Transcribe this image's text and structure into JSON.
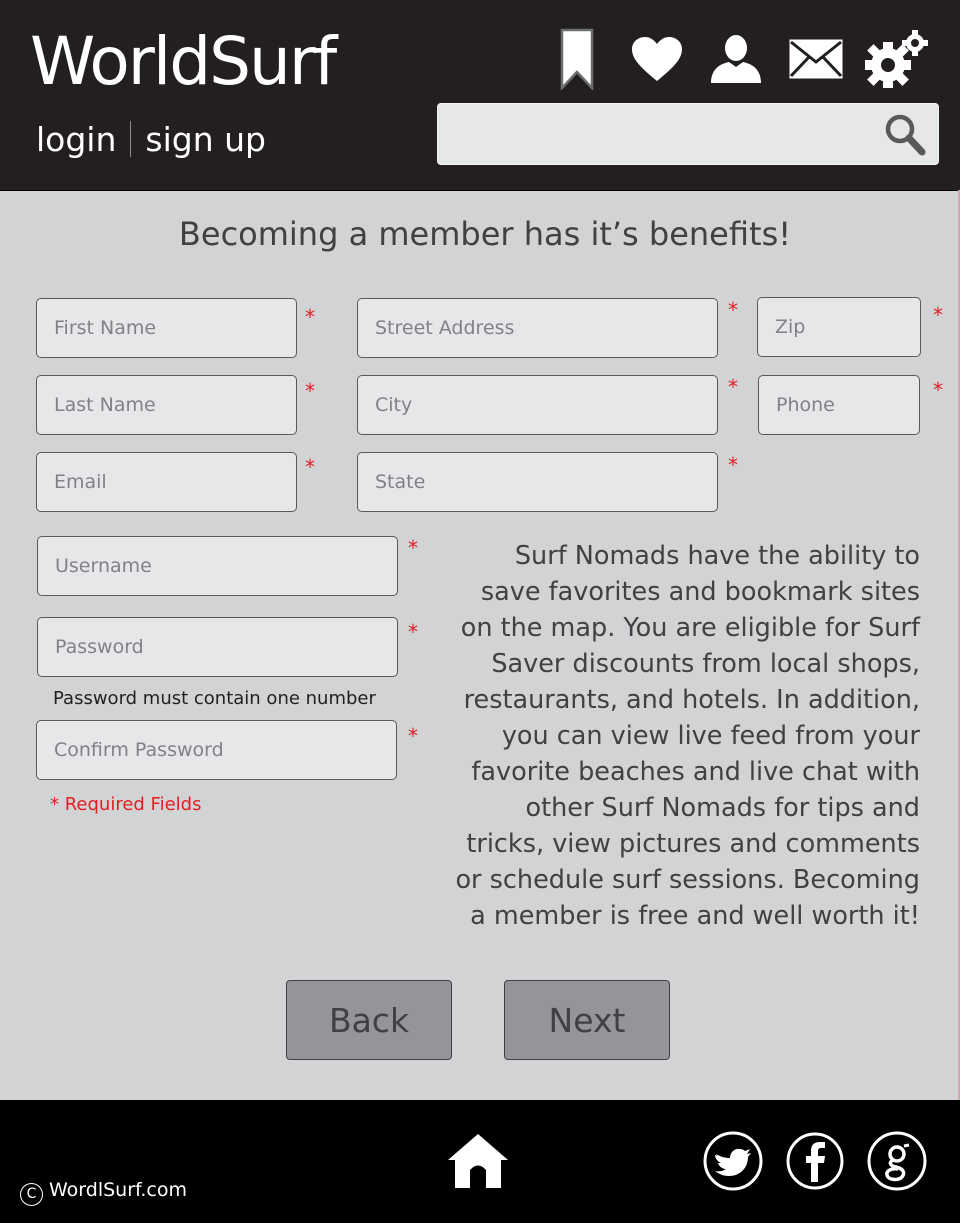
{
  "header": {
    "logo": "WorldSurf",
    "login": "login",
    "signup": "sign up",
    "icons": [
      "bookmark-icon",
      "heart-icon",
      "user-icon",
      "mail-icon",
      "settings-gears-icon"
    ],
    "search_placeholder": "",
    "search_icon": "search-icon"
  },
  "headline": "Becoming a member has it’s benefits!",
  "form": {
    "first_name": "First Name",
    "last_name": "Last Name",
    "email": "Email",
    "street": "Street Address",
    "city": "City",
    "state": "State",
    "zip": "Zip",
    "phone": "Phone",
    "username": "Username",
    "password": "Password",
    "password_hint": "Password must contain one number",
    "confirm_password": "Confirm Password",
    "required_note": "* Required Fields",
    "asterisk": "*"
  },
  "description": "Surf Nomads have the ability to save favorites and bookmark sites on the map.  You are eligible for Surf Saver discounts from local shops, restaurants, and hotels.  In addition, you can view live feed from your favorite beaches and live chat with other Surf Nomads for tips and tricks, view pictures and comments or schedule surf sessions.  Becoming a member is free and well worth it!",
  "buttons": {
    "back": "Back",
    "next": "Next"
  },
  "footer": {
    "copyright": "WordlSurf.com",
    "copyright_symbol": "C",
    "icons": [
      "home-icon",
      "twitter-icon",
      "facebook-icon",
      "google-icon"
    ]
  },
  "colors": {
    "header_bg": "#231f20",
    "page_bg": "#d2d3d5",
    "required": "#e31e24",
    "button": "#939598",
    "footer_bg": "#000000"
  }
}
